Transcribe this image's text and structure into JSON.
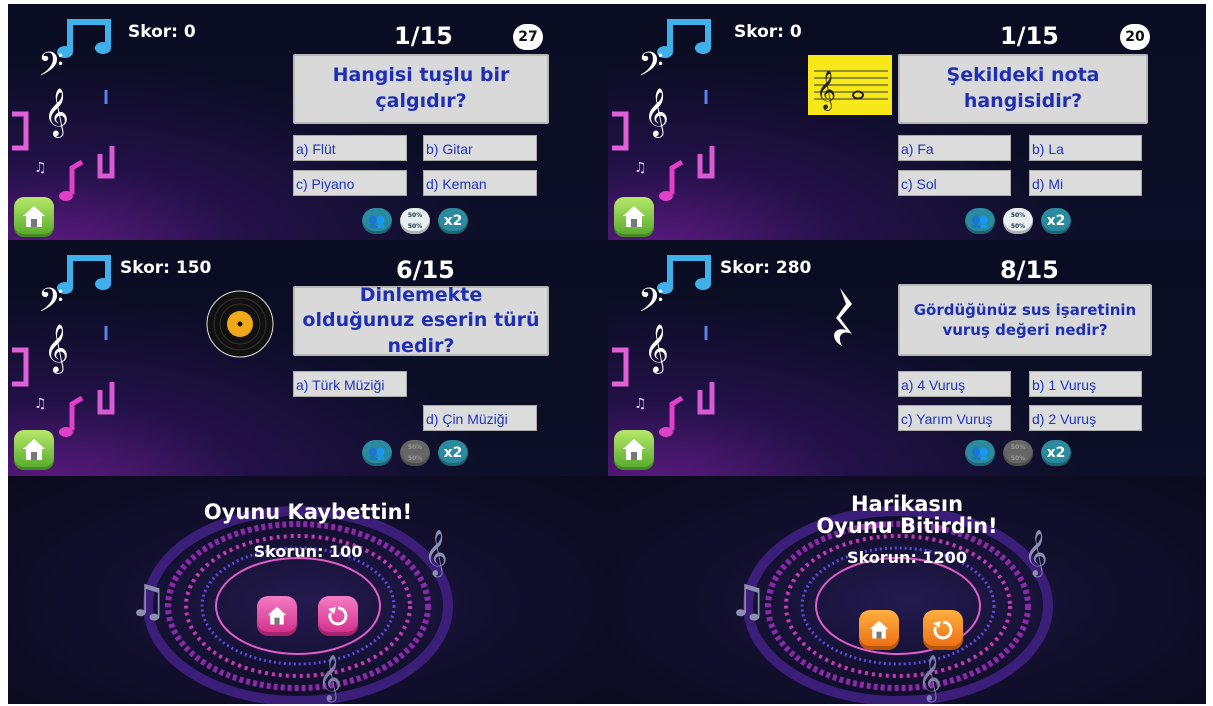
{
  "colors": {
    "question_text": "#1f2fb4",
    "lifeline": "#2b8a9e",
    "home_button": "#6bbf3a",
    "lose_buttons": "#e0479e",
    "win_buttons": "#f47b1a"
  },
  "panels": [
    {
      "score": "Skor: 0",
      "counter": "1/15",
      "timer": "27",
      "question": "Hangisi tuşlu bir çalgıdır?",
      "media": "none",
      "answers": [
        "a) Flüt",
        "b) Gitar",
        "c) Piyano",
        "d) Keman"
      ]
    },
    {
      "score": "Skor: 0",
      "counter": "1/15",
      "timer": "20",
      "question": "Şekildeki nota hangisidir?",
      "media": "note-staff-image",
      "answers": [
        "a) Fa",
        "b) La",
        "c) Sol",
        "d) Mi"
      ]
    },
    {
      "score": "Skor: 150",
      "counter": "6/15",
      "question": "Dinlemekte olduğunuz eserin türü nedir?",
      "media": "vinyl-record-icon",
      "answers": [
        "a) Türk Müziği",
        "d) Çin Müziği"
      ]
    },
    {
      "score": "Skor: 280",
      "counter": "8/15",
      "question": "Gördüğünüz sus işaretinin vuruş değeri nedir?",
      "media": "quarter-rest-icon",
      "answers": [
        "a) 4 Vuruş",
        "b) 1 Vuruş",
        "c) Yarım Vuruş",
        "d) 2 Vuruş"
      ]
    }
  ],
  "lifelines": {
    "audience": "audience-icon",
    "fifty_top": "50%",
    "fifty_bottom": "50%",
    "double": "x2"
  },
  "end_screens": [
    {
      "title_line1": "Oyunu Kaybettin!",
      "title_line2": "",
      "score": "Skorun: 100"
    },
    {
      "title_line1": "Harikasın",
      "title_line2": "Oyunu Bitirdin!",
      "score": "Skorun: 1200"
    }
  ],
  "icons": [
    "music-note-icon",
    "bass-clef-icon",
    "treble-clef-icon",
    "home-icon",
    "restart-icon"
  ]
}
